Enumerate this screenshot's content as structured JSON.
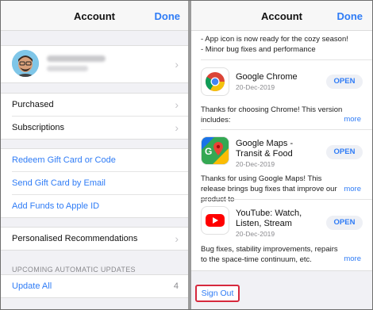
{
  "left": {
    "nav": {
      "title": "Account",
      "done": "Done"
    },
    "group1": [
      {
        "label": "Purchased"
      },
      {
        "label": "Subscriptions"
      }
    ],
    "group2": [
      {
        "label": "Redeem Gift Card or Code"
      },
      {
        "label": "Send Gift Card by Email"
      },
      {
        "label": "Add Funds to Apple ID"
      }
    ],
    "group3": [
      {
        "label": "Personalised Recommendations"
      }
    ],
    "section_header": "UPCOMING AUTOMATIC UPDATES",
    "update_all": {
      "label": "Update All",
      "count": "4"
    }
  },
  "right": {
    "nav": {
      "title": "Account",
      "done": "Done"
    },
    "top_notes": [
      "- App icon is now ready for the cozy season!",
      "- Minor bug fixes and performance"
    ],
    "apps": [
      {
        "name": "Google Chrome",
        "date": "20-Dec-2019",
        "button": "OPEN",
        "note": "Thanks for choosing Chrome! This version includes:",
        "more": "more"
      },
      {
        "name": "Google Maps - Transit & Food",
        "date": "20-Dec-2019",
        "button": "OPEN",
        "note": "Thanks for using Google Maps! This release brings bug fixes that improve our product to",
        "more": "more"
      },
      {
        "name": "YouTube: Watch, Listen, Stream",
        "date": "20-Dec-2019",
        "button": "OPEN",
        "note": "Bug fixes, stability improvements, repairs to the space-time continuum, etc.",
        "more": "more"
      }
    ],
    "sign_out": "Sign Out"
  },
  "colors": {
    "accent": "#2f7cf6",
    "highlight": "#d6293e"
  },
  "icons": [
    "chevron-right-icon",
    "memoji-avatar",
    "chrome-icon",
    "google-maps-icon",
    "youtube-icon"
  ]
}
